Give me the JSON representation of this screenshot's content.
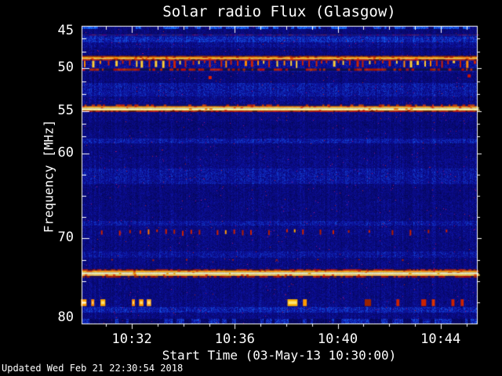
{
  "footer": {
    "updated": "Updated Wed Feb 21 22:30:54 2018"
  },
  "chart_data": {
    "type": "heatmap",
    "title": "Solar radio Flux (Glasgow)",
    "xlabel": "Start Time (03-May-13 10:30:00)",
    "ylabel": "Frequency [MHz]",
    "y_min": 45,
    "y_max": 80,
    "y_axis_direction": "increasing-downward",
    "y_major_ticks": [
      45,
      50,
      55,
      60,
      70,
      80
    ],
    "y_minor_ticks": [
      46.5,
      48,
      51.5,
      53,
      56.5,
      58,
      62.5,
      65,
      67.5,
      72.5,
      75,
      77.5
    ],
    "x_start_time": "10:30:00",
    "x_total_minutes": 15.4,
    "x_major_ticks": [
      {
        "minute": 2,
        "label": "10:32"
      },
      {
        "minute": 6,
        "label": "10:36"
      },
      {
        "minute": 10,
        "label": "10:40"
      },
      {
        "minute": 14,
        "label": "10:44"
      }
    ],
    "x_minor_tick_every_minutes": 1,
    "persistent_bright_lines_mhz": [
      49.0,
      55.0,
      74.2
    ],
    "comb_rfi_range_mhz": [
      49.1,
      50.3
    ],
    "palette": {
      "background": "#000000",
      "text": "#ffffff",
      "base_blue": "#0000aa",
      "bright_blue": "#2244ff",
      "red": "#cc2200",
      "orange": "#ff8800",
      "yellow": "#ffee66"
    },
    "background_bands": [
      {
        "f0": 45.0,
        "f1": 45.3,
        "level": 0.78
      },
      {
        "f0": 45.3,
        "f1": 45.95,
        "level": 0.4
      },
      {
        "f0": 45.95,
        "f1": 46.25,
        "level": 0.55
      },
      {
        "f0": 46.25,
        "f1": 46.9,
        "level": 0.68
      },
      {
        "f0": 46.9,
        "f1": 47.55,
        "level": 0.5
      },
      {
        "f0": 47.55,
        "f1": 48.48,
        "level": 0.42
      },
      {
        "f0": 48.48,
        "f1": 50.35,
        "level": 0.52
      },
      {
        "f0": 50.35,
        "f1": 51.65,
        "level": 0.42
      },
      {
        "f0": 51.65,
        "f1": 53.2,
        "level": 0.58
      },
      {
        "f0": 53.2,
        "f1": 54.2,
        "level": 0.47
      },
      {
        "f0": 54.2,
        "f1": 55.15,
        "level": 0.45
      },
      {
        "f0": 55.15,
        "f1": 56.2,
        "level": 0.44
      },
      {
        "f0": 56.2,
        "f1": 57.1,
        "level": 0.4
      },
      {
        "f0": 57.1,
        "f1": 58.25,
        "level": 0.44
      },
      {
        "f0": 58.25,
        "f1": 58.8,
        "level": 0.6
      },
      {
        "f0": 58.8,
        "f1": 60.2,
        "level": 0.43
      },
      {
        "f0": 60.2,
        "f1": 61.7,
        "level": 0.46
      },
      {
        "f0": 61.7,
        "f1": 63.6,
        "level": 0.56
      },
      {
        "f0": 63.6,
        "f1": 65.5,
        "level": 0.42
      },
      {
        "f0": 65.5,
        "f1": 67.9,
        "level": 0.44
      },
      {
        "f0": 67.9,
        "f1": 68.4,
        "level": 0.57
      },
      {
        "f0": 68.4,
        "f1": 69.7,
        "level": 0.46
      },
      {
        "f0": 69.7,
        "f1": 71.5,
        "level": 0.44
      },
      {
        "f0": 71.5,
        "f1": 72.25,
        "level": 0.55
      },
      {
        "f0": 72.25,
        "f1": 73.6,
        "level": 0.44
      },
      {
        "f0": 73.6,
        "f1": 74.8,
        "level": 0.45
      },
      {
        "f0": 74.8,
        "f1": 77.05,
        "level": 0.44
      },
      {
        "f0": 77.05,
        "f1": 78.0,
        "level": 0.46
      },
      {
        "f0": 78.0,
        "f1": 78.65,
        "level": 0.64
      },
      {
        "f0": 78.65,
        "f1": 79.4,
        "level": 0.45
      },
      {
        "f0": 79.4,
        "f1": 80.0,
        "level": 0.58
      }
    ],
    "features": [
      {
        "kind": "rowband",
        "f0": 46.0,
        "f1": 46.14,
        "color": "#46156e",
        "jitter": 40,
        "break_chance": 0.45,
        "break_color": "#1a1a7e"
      },
      {
        "kind": "rowband",
        "f0": 48.5,
        "f1": 48.64,
        "color": "#7a1a00",
        "jitter": 36,
        "break_chance": 0.25,
        "break_color": "#3a0c20"
      },
      {
        "kind": "rowband",
        "f0": 48.64,
        "f1": 48.78,
        "color": "#ff9100",
        "jitter": 44,
        "break_chance": 0.15,
        "break_color": "#cc3300"
      },
      {
        "kind": "rowband",
        "f0": 48.78,
        "f1": 48.93,
        "color": "#ffd24d",
        "jitter": 38,
        "break_chance": 0.12,
        "break_color": "#ff6600"
      },
      {
        "kind": "rowband",
        "f0": 48.93,
        "f1": 49.07,
        "color": "#cc2200",
        "jitter": 40,
        "break_chance": 0.3,
        "break_color": "#551000"
      },
      {
        "kind": "comb",
        "f0": 49.1,
        "f1": 50.0,
        "period": 8.2,
        "colors": [
          "#cc2200",
          "#ffcc33",
          "#ff8800"
        ]
      },
      {
        "kind": "rowband",
        "f0": 50.02,
        "f1": 50.28,
        "color": "#aa1c00",
        "jitter": 46,
        "break_chance": 0.5,
        "break_color": "#10104a"
      },
      {
        "kind": "rowband",
        "f0": 54.25,
        "f1": 54.45,
        "color": "#c03000",
        "jitter": 50,
        "break_chance": 0.62,
        "break_color": "#101060"
      },
      {
        "kind": "rowband",
        "f0": 54.45,
        "f1": 54.6,
        "color": "#ff8800",
        "jitter": 40,
        "break_chance": 0.1,
        "break_color": "#dd3300"
      },
      {
        "kind": "rowband",
        "f0": 54.6,
        "f1": 54.72,
        "color": "#ffe866",
        "jitter": 26,
        "break_chance": 0.06,
        "break_color": "#ee5500"
      },
      {
        "kind": "rowband",
        "f0": 54.72,
        "f1": 54.86,
        "color": "#ffffbb",
        "jitter": 22,
        "break_chance": 0.05,
        "break_color": "#ff7700"
      },
      {
        "kind": "rowband",
        "f0": 54.86,
        "f1": 54.98,
        "color": "#ffe866",
        "jitter": 26,
        "break_chance": 0.06,
        "break_color": "#ee5500"
      },
      {
        "kind": "rowband",
        "f0": 54.98,
        "f1": 55.12,
        "color": "#cc2200",
        "jitter": 40,
        "break_chance": 0.25,
        "break_color": "#661200"
      },
      {
        "kind": "dashes",
        "f0": 68.9,
        "f1": 69.55,
        "w": 2,
        "items": [
          {
            "m": 0.8,
            "c": "#cc2200"
          },
          {
            "m": 1.5,
            "c": "#cc2200"
          },
          {
            "m": 1.9,
            "c": "#b01e00"
          },
          {
            "m": 2.3,
            "c": "#cc2200"
          },
          {
            "m": 2.62,
            "c": "#ff7700"
          },
          {
            "m": 2.95,
            "c": "#cc2200"
          },
          {
            "m": 3.3,
            "c": "#cc2200"
          },
          {
            "m": 3.62,
            "c": "#b01e00"
          },
          {
            "m": 3.95,
            "c": "#cc2200"
          },
          {
            "m": 4.28,
            "c": "#cc2200"
          },
          {
            "m": 4.6,
            "c": "#b01e00"
          },
          {
            "m": 5.3,
            "c": "#cc2200"
          },
          {
            "m": 5.62,
            "c": "#ff9900"
          },
          {
            "m": 5.95,
            "c": "#cc2200"
          },
          {
            "m": 6.28,
            "c": "#b01e00"
          },
          {
            "m": 6.6,
            "c": "#cc2200"
          },
          {
            "m": 7.3,
            "c": "#b01e00"
          },
          {
            "m": 8.0,
            "c": "#cc2200"
          },
          {
            "m": 8.3,
            "c": "#ffaa00"
          },
          {
            "m": 8.62,
            "c": "#cc2200"
          },
          {
            "m": 9.3,
            "c": "#b01e00"
          },
          {
            "m": 9.8,
            "c": "#cc2200"
          },
          {
            "m": 10.4,
            "c": "#b01e00"
          },
          {
            "m": 11.2,
            "c": "#cc2200"
          },
          {
            "m": 12.1,
            "c": "#b01e00"
          },
          {
            "m": 12.8,
            "c": "#cc2200"
          },
          {
            "m": 13.5,
            "c": "#b01e00"
          },
          {
            "m": 14.2,
            "c": "#cc2200"
          }
        ]
      },
      {
        "kind": "dashes",
        "f0": 72.4,
        "f1": 72.62,
        "w": 2,
        "items": [
          {
            "m": 1.2,
            "c": "#aa1c00"
          },
          {
            "m": 2.8,
            "c": "#aa1c00"
          },
          {
            "m": 4.1,
            "c": "#aa1c00"
          },
          {
            "m": 5.9,
            "c": "#aa1c00"
          },
          {
            "m": 7.6,
            "c": "#aa1c00"
          },
          {
            "m": 9.2,
            "c": "#aa1c00"
          },
          {
            "m": 10.8,
            "c": "#aa1c00"
          },
          {
            "m": 12.5,
            "c": "#aa1c00"
          }
        ]
      },
      {
        "kind": "rowband",
        "f0": 73.62,
        "f1": 73.78,
        "color": "#bb2000",
        "jitter": 46,
        "break_chance": 0.4,
        "break_color": "#400c20"
      },
      {
        "kind": "rowband",
        "f0": 73.78,
        "f1": 73.94,
        "color": "#ff9900",
        "jitter": 40,
        "break_chance": 0.1,
        "break_color": "#dd4400"
      },
      {
        "kind": "rowband",
        "f0": 73.94,
        "f1": 74.06,
        "color": "#ffe877",
        "jitter": 24,
        "break_chance": 0.05,
        "break_color": "#ff7700"
      },
      {
        "kind": "rowband",
        "f0": 74.06,
        "f1": 74.22,
        "color": "#ffffc8",
        "jitter": 20,
        "break_chance": 0.04,
        "break_color": "#ffaa00"
      },
      {
        "kind": "rowband",
        "f0": 74.22,
        "f1": 74.4,
        "color": "#ffd24d",
        "jitter": 30,
        "break_chance": 0.08,
        "break_color": "#ee5500"
      },
      {
        "kind": "rowband",
        "f0": 74.4,
        "f1": 74.6,
        "color": "#aa1a00",
        "jitter": 46,
        "break_chance": 0.45,
        "break_color": "#2a1050"
      },
      {
        "kind": "blobs",
        "f0": 77.15,
        "f1": 77.95,
        "items": [
          {
            "m0": 0.02,
            "m1": 0.24,
            "c": "#ff9900",
            "bright": 1
          },
          {
            "m0": 0.42,
            "m1": 0.54,
            "c": "#ff8800",
            "bright": 1
          },
          {
            "m0": 0.78,
            "m1": 0.97,
            "c": "#ffaa00",
            "bright": 1
          },
          {
            "m0": 2.0,
            "m1": 2.12,
            "c": "#ff8800",
            "bright": 1
          },
          {
            "m0": 2.28,
            "m1": 2.45,
            "c": "#ff9900",
            "bright": 1
          },
          {
            "m0": 2.58,
            "m1": 2.75,
            "c": "#ffaa22",
            "bright": 1
          },
          {
            "m0": 8.05,
            "m1": 8.44,
            "c": "#ffb300",
            "bright": 1
          },
          {
            "m0": 8.65,
            "m1": 8.8,
            "c": "#ff9900",
            "bright": 0
          },
          {
            "m0": 11.05,
            "m1": 11.3,
            "c": "#992200",
            "bright": 0
          },
          {
            "m0": 12.28,
            "m1": 12.4,
            "c": "#cc2200",
            "bright": 0
          },
          {
            "m0": 13.25,
            "m1": 13.44,
            "c": "#cc2200",
            "bright": 0
          },
          {
            "m0": 13.66,
            "m1": 13.78,
            "c": "#dd3300",
            "bright": 0
          },
          {
            "m0": 14.42,
            "m1": 14.54,
            "c": "#cc2200",
            "bright": 0
          },
          {
            "m0": 14.78,
            "m1": 14.9,
            "c": "#cc2200",
            "bright": 0
          }
        ]
      },
      {
        "kind": "dots",
        "items": [
          {
            "m": 4.98,
            "f": 50.9,
            "c": "#dd2200",
            "s": 4
          },
          {
            "m": 15.05,
            "f": 50.7,
            "c": "#cc1100",
            "s": 4
          }
        ]
      }
    ]
  }
}
